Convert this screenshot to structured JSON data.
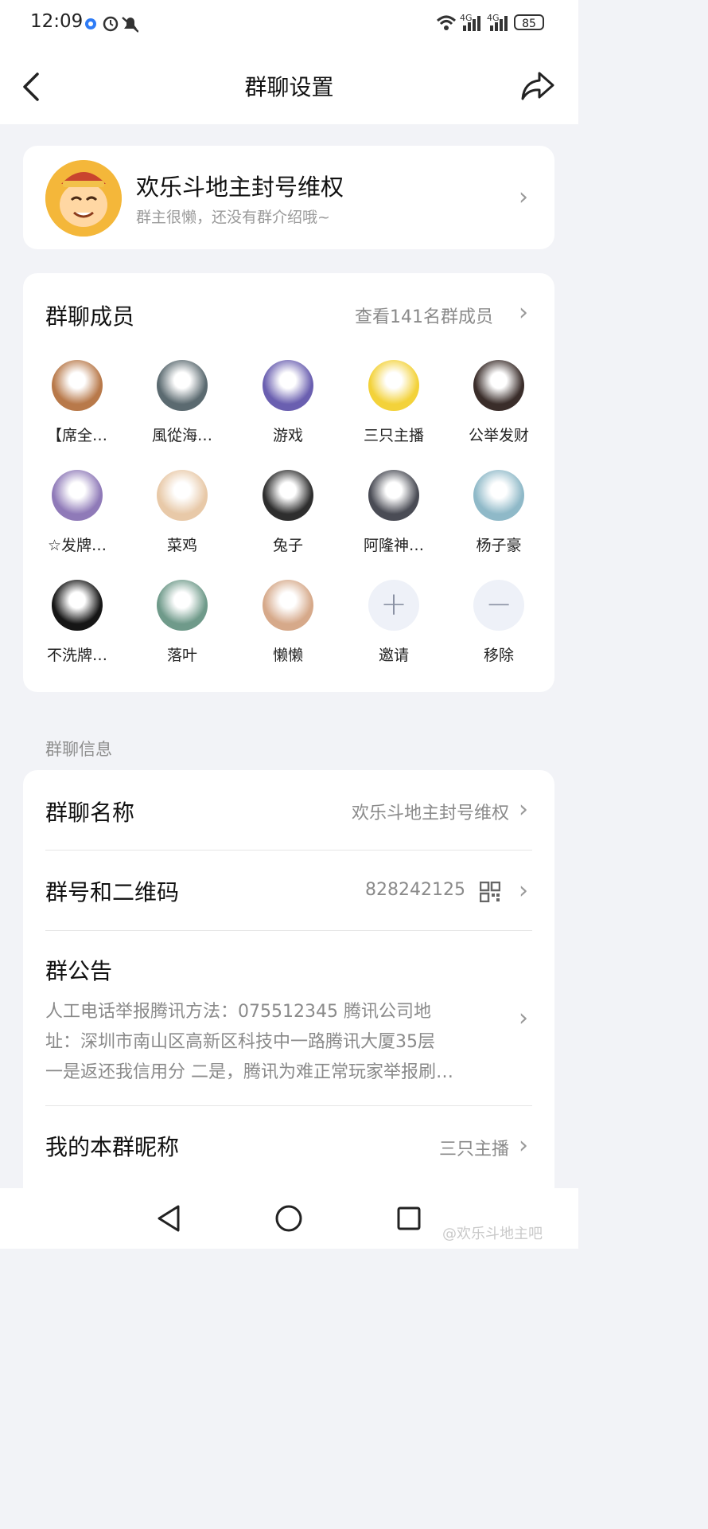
{
  "status_bar": {
    "time": "12:09",
    "battery": "85",
    "network_1": "4G",
    "network_2": "4G"
  },
  "header": {
    "title": "群聊设置",
    "back_icon": "chevron-left-icon",
    "share_icon": "share-icon"
  },
  "group": {
    "name": "欢乐斗地主封号维权",
    "intro": "群主很懒，还没有群介绍哦~"
  },
  "members": {
    "title": "群聊成员",
    "view_all": "查看141名群成员",
    "list": [
      {
        "name": "【席全…",
        "color": "#b8794a"
      },
      {
        "name": "風從海…",
        "color": "#5b6a70"
      },
      {
        "name": "游戏",
        "color": "#6a5fb0"
      },
      {
        "name": "三只主播",
        "color": "#f3d23a"
      },
      {
        "name": "公举发财",
        "color": "#3a2d2a"
      },
      {
        "name": "☆发牌…",
        "color": "#8f7ab8"
      },
      {
        "name": "菜鸡",
        "color": "#e8c9a8"
      },
      {
        "name": "兔子",
        "color": "#2e2e2e"
      },
      {
        "name": "阿隆神…",
        "color": "#4a4c55"
      },
      {
        "name": "杨子豪",
        "color": "#8fb9c8"
      },
      {
        "name": "不洗牌…",
        "color": "#161616"
      },
      {
        "name": "落叶",
        "color": "#6f9a8a"
      },
      {
        "name": "懒懒",
        "color": "#d6a98a"
      }
    ],
    "invite_label": "邀请",
    "remove_label": "移除"
  },
  "info": {
    "section_label": "群聊信息",
    "name_label": "群聊名称",
    "name_value": "欢乐斗地主封号维权",
    "number_label": "群号和二维码",
    "number_value": "828242125",
    "notice_label": "群公告",
    "notice_line1": "人工电话举报腾讯方法：075512345 腾讯公司地",
    "notice_line2": "址：深圳市南山区高新区科技中一路腾讯大厦35层",
    "notice_line3": "一是返还我信用分 二是，腾讯为难正常玩家举报刷…",
    "nickname_label": "我的本群昵称",
    "nickname_value": "三只主播"
  },
  "watermark": "@欢乐斗地主吧"
}
